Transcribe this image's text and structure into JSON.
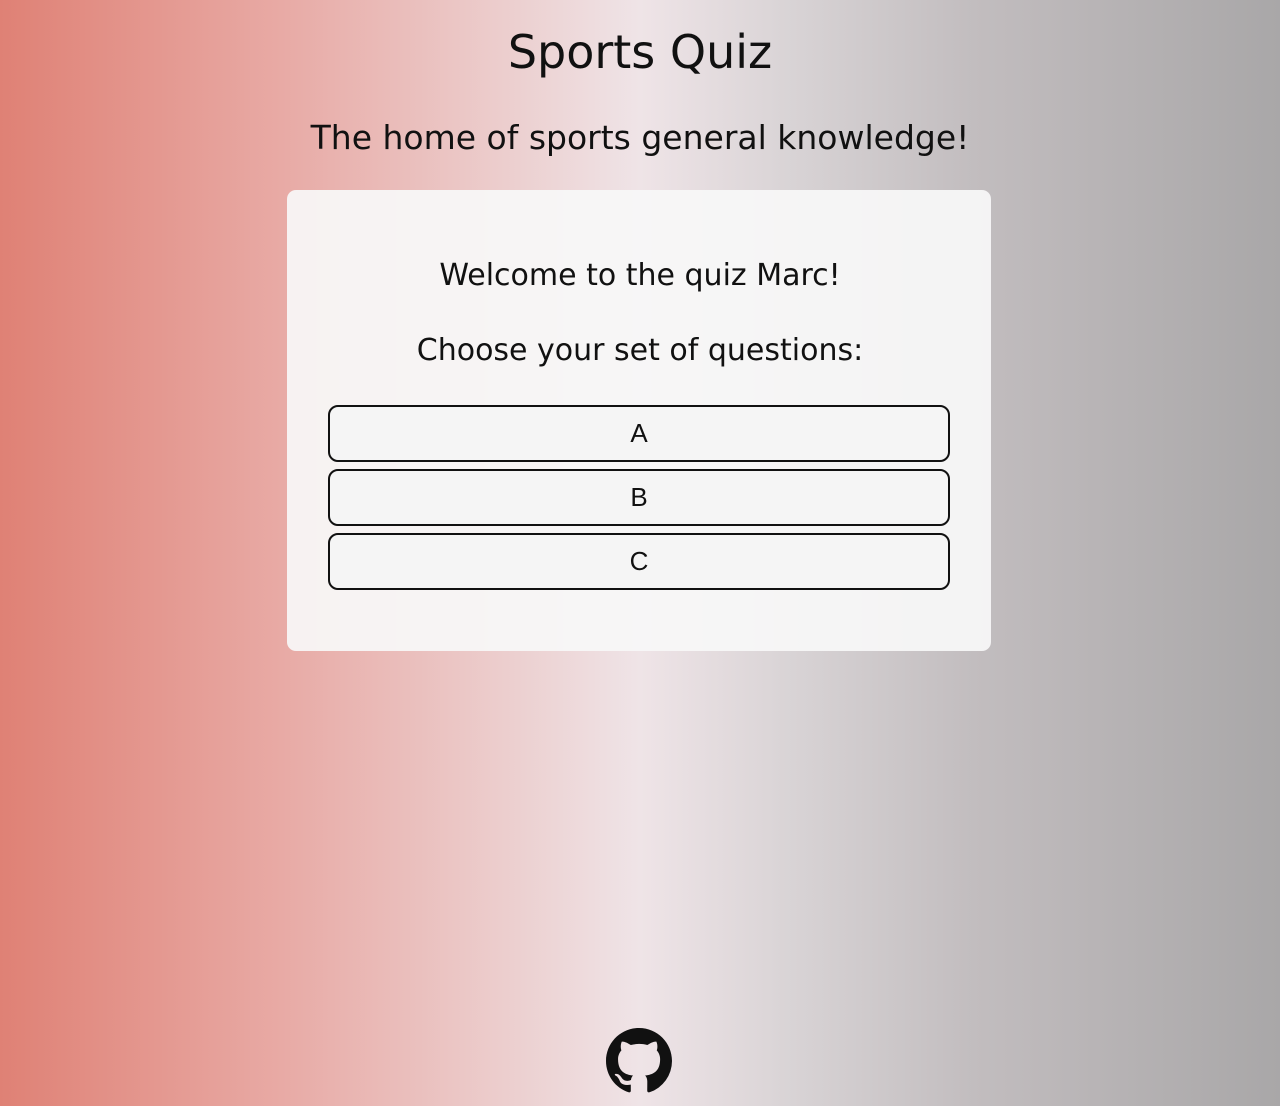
{
  "header": {
    "title": "Sports Quiz",
    "tagline": "The home of sports general knowledge!"
  },
  "quiz_card": {
    "welcome_text": "Welcome to the quiz Marc!",
    "prompt_text": "Choose your set of questions:",
    "sets": [
      {
        "label": "A"
      },
      {
        "label": "B"
      },
      {
        "label": "C"
      }
    ]
  },
  "footer": {
    "icon": "github-icon"
  },
  "colors": {
    "gradient_left": "#df8175",
    "gradient_center": "#efe4e7",
    "gradient_right": "#a9a7a8",
    "card_background": "#f8f7f7",
    "button_background": "#f5f5f5",
    "text": "#111111"
  }
}
